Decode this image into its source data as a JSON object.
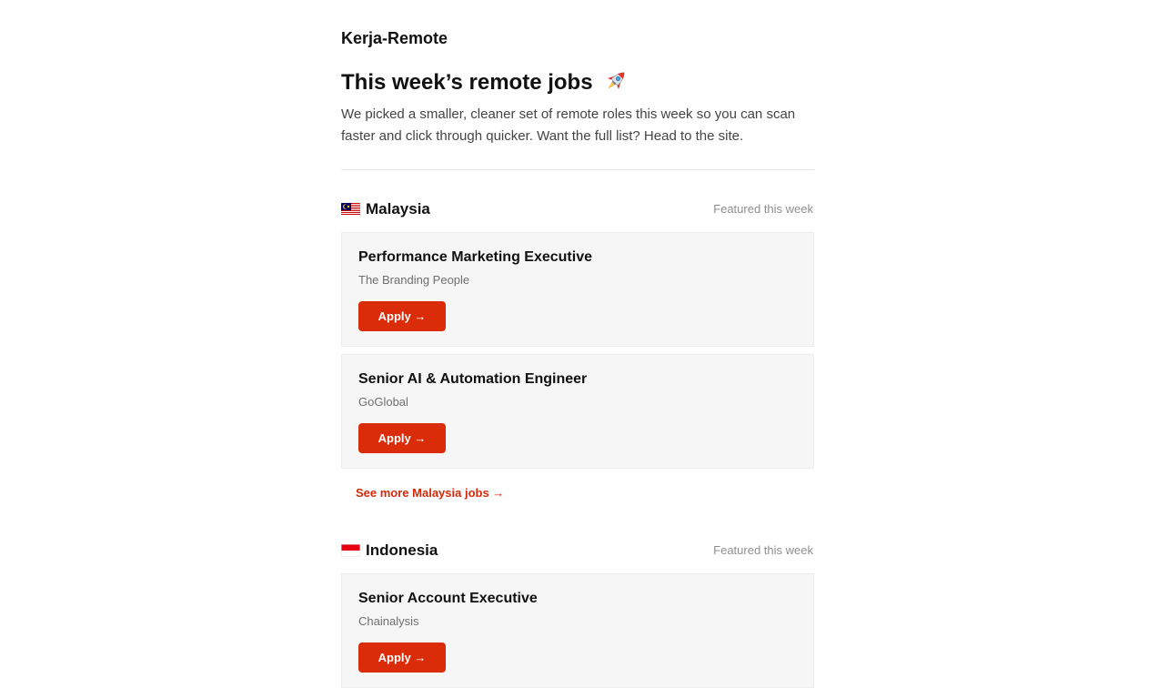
{
  "brand": "Kerja-Remote",
  "headline": "This week’s remote jobs",
  "headline_icon": "rocket-icon",
  "intro": "We picked a smaller, cleaner set of remote roles this week so you can scan faster and click through quicker. Want the full list? Head to the site.",
  "colors": {
    "accent": "#db2c0a",
    "card_bg": "#f6f6f6",
    "muted_text": "#8f8f8f"
  },
  "sections": [
    {
      "country": "Malaysia",
      "flag_icon": "malaysia-flag-icon",
      "featured": "Featured this week",
      "jobs": [
        {
          "title": "Performance Marketing Executive",
          "company": "The Branding People",
          "apply": "Apply →"
        },
        {
          "title": "Senior AI & Automation Engineer",
          "company": "GoGlobal",
          "apply": "Apply →"
        }
      ],
      "see_more": "See more Malaysia jobs →"
    },
    {
      "country": "Indonesia",
      "flag_icon": "indonesia-flag-icon",
      "featured": "Featured this week",
      "jobs": [
        {
          "title": "Senior Account Executive",
          "company": "Chainalysis",
          "apply": "Apply →"
        }
      ]
    }
  ]
}
